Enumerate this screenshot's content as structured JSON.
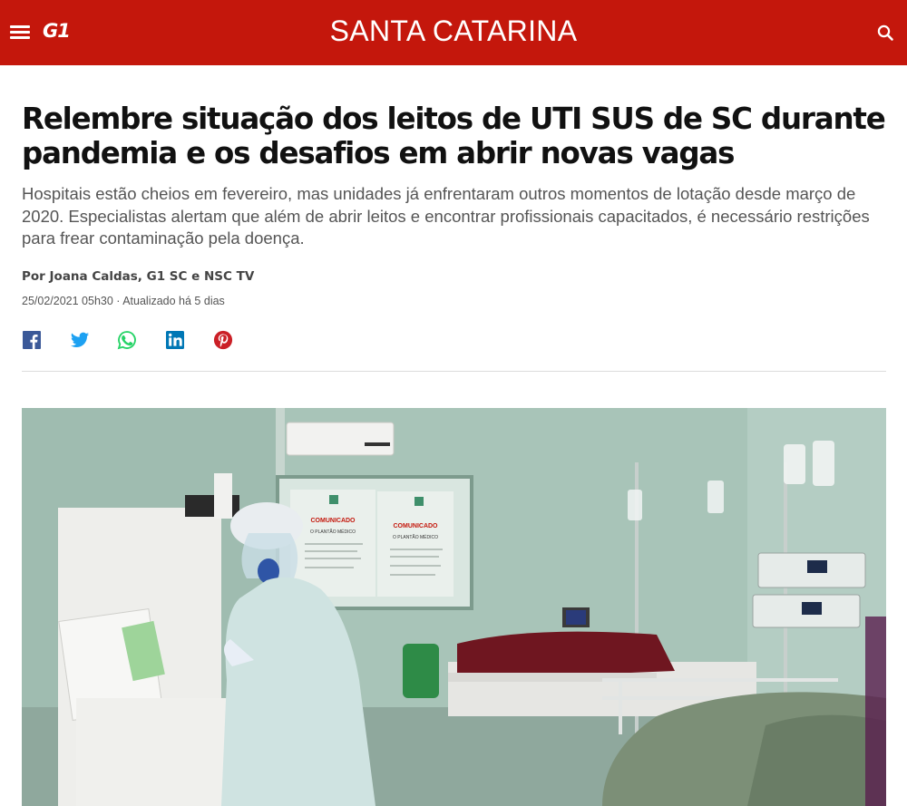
{
  "header": {
    "logo_text": "G1",
    "section_title": "SANTA CATARINA",
    "bg_color": "#c4170c",
    "menu_icon": "hamburger-menu-icon",
    "search_icon": "search-icon"
  },
  "article": {
    "headline": "Relembre situação dos leitos de UTI SUS de SC durante pandemia e os desafios em abrir novas vagas",
    "subtitle": "Hospitais estão cheios em fevereiro, mas unidades já enfrentaram outros momentos de lotação desde março de 2020. Especialistas alertam que além de abrir leitos e encontrar profissionais capacitados, é necessário restrições para frear contaminação pela doença.",
    "byline": "Por Joana Caldas, G1 SC e NSC TV",
    "dateline": "25/02/2021 05h30 · Atualizado há 5 dias"
  },
  "share": [
    {
      "icon": "facebook-icon",
      "color": "#3b5998"
    },
    {
      "icon": "twitter-icon",
      "color": "#1da1f2"
    },
    {
      "icon": "whatsapp-icon",
      "color": "#25d366"
    },
    {
      "icon": "linkedin-icon",
      "color": "#0077b5"
    },
    {
      "icon": "pinterest-icon",
      "color": "#cb2027"
    }
  ],
  "photo": {
    "poster_title": "COMUNICADO",
    "poster_subtitle": "O PLANTÃO MÉDICO"
  }
}
